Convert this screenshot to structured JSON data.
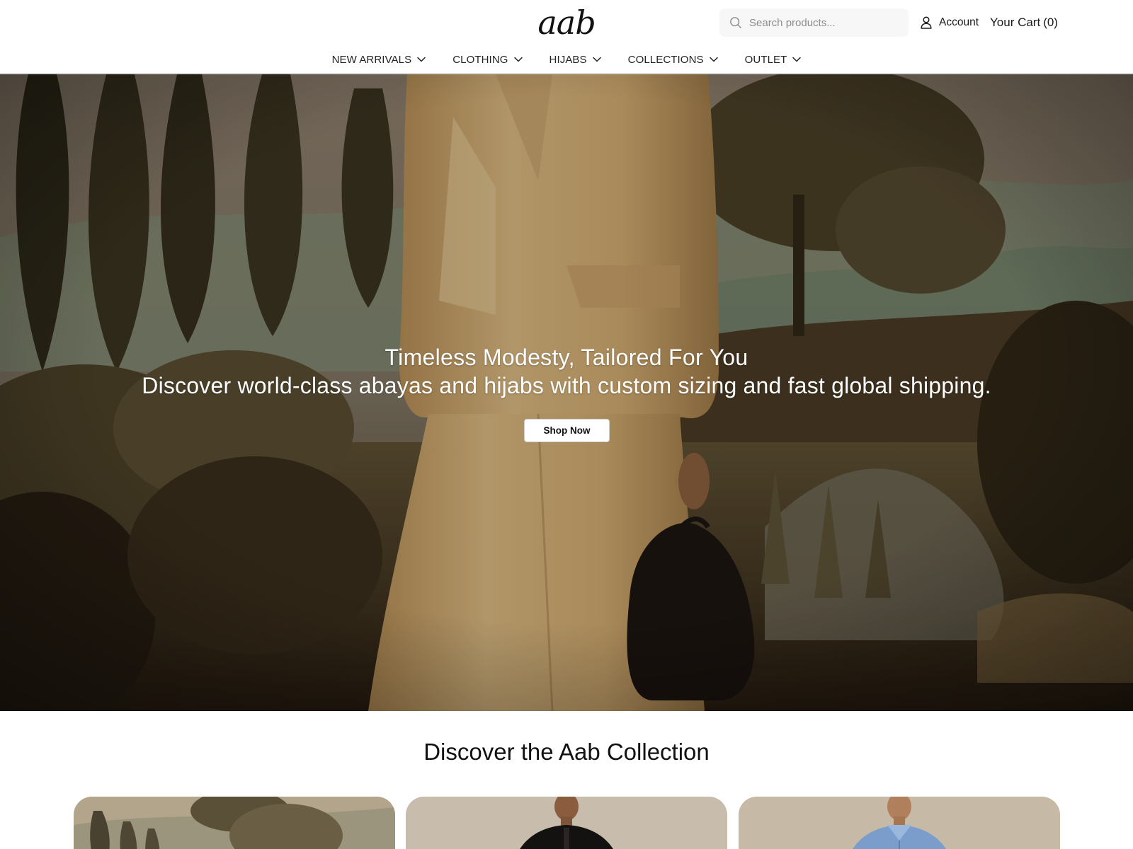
{
  "header": {
    "logo_text": "aab",
    "search": {
      "placeholder": "Search products..."
    },
    "account_label": "Account",
    "cart": {
      "label": "Your Cart",
      "count_text": "(0)"
    }
  },
  "nav": {
    "items": [
      {
        "label": "NEW ARRIVALS",
        "icon": "chevron-down-icon"
      },
      {
        "label": "CLOTHING",
        "icon": "chevron-down-icon"
      },
      {
        "label": "HIJABS",
        "icon": "chevron-down-icon"
      },
      {
        "label": "COLLECTIONS",
        "icon": "chevron-down-icon"
      },
      {
        "label": "OUTLET",
        "icon": "chevron-down-icon"
      }
    ]
  },
  "hero": {
    "title": "Timeless Modesty, Tailored For You",
    "subtitle": "Discover world-class abayas and hijabs with custom sizing and fast global shipping.",
    "cta_label": "Shop Now"
  },
  "collection": {
    "title": "Discover the Aab Collection"
  },
  "colors": {
    "text_primary": "#111111",
    "hero_text": "#ffffff",
    "search_bg": "#f7f7f7",
    "header_border": "#d9d9d9"
  }
}
